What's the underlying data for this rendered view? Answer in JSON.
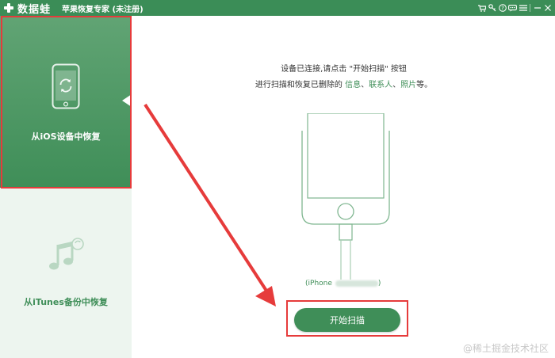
{
  "titlebar": {
    "logo_text": "数据蛙",
    "app_title": "苹果恢复专家 (未注册)",
    "icons": [
      "cart-icon",
      "key-icon",
      "help-icon",
      "chat-icon",
      "menu-icon",
      "minimize-icon",
      "close-icon"
    ]
  },
  "sidebar": {
    "items": [
      {
        "label": "从iOS设备中恢复",
        "icon": "phone-restore-icon",
        "active": true
      },
      {
        "label": "从iTunes备份中恢复",
        "icon": "itunes-music-icon",
        "active": false
      }
    ]
  },
  "main": {
    "instruction_line1": "设备已连接,请点击 \"开始扫描\" 按钮",
    "instruction_line2_prefix": "进行扫描和恢复已删除的 ",
    "instruction_link1": "信息",
    "instruction_sep1": "、",
    "instruction_link2": "联系人",
    "instruction_sep2": "、",
    "instruction_link3": "照片",
    "instruction_suffix": "等。",
    "device_prefix": "(iPhone",
    "device_suffix": ")",
    "start_button": "开始扫描"
  },
  "watermark": "@稀土掘金技术社区",
  "colors": {
    "brand_green": "#3f8e58",
    "sidebar_bg": "#edf5ef",
    "highlight_red": "#e63b3b"
  }
}
